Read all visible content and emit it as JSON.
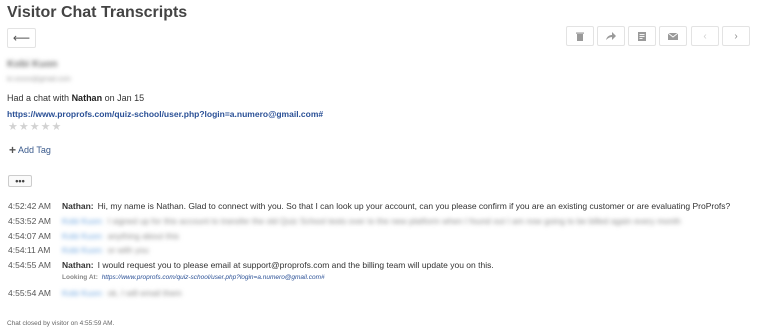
{
  "page": {
    "title": "Visitor Chat Transcripts"
  },
  "toolbar": {
    "back_icon": "arrow-left-icon",
    "actions": [
      "trash-icon",
      "forward-icon",
      "note-icon",
      "envelope-icon",
      "chevron-left-icon",
      "chevron-right-icon"
    ],
    "glyphs": {
      "back": "⟵",
      "delete": "🗑",
      "forward": "➦",
      "note": "▤",
      "mail": "✉",
      "prev": "‹",
      "next": "›"
    }
  },
  "visitor": {
    "name": "Kobi Kuon",
    "email": "kr.xxxxx@gmail.com",
    "chat_prefix": "Had a chat with",
    "agent": "Nathan",
    "chat_suffix": "on Jan 15",
    "page_url": "https://www.proprofs.com/quiz-school/user.php?login=a.numero@gmail.com#",
    "rating": 0,
    "stars": [
      "★",
      "★",
      "★",
      "★",
      "★"
    ]
  },
  "tags": {
    "add_label": "Add Tag",
    "plus": "+"
  },
  "more_label": "•••",
  "messages": [
    {
      "time": "4:52:42 AM",
      "sender": "Nathan:",
      "type": "agent",
      "text": "Hi, my name is Nathan. Glad to connect with you. So that I can look up your account, can you please confirm if you are an existing customer or are evaluating ProProfs?"
    },
    {
      "time": "4:53:52 AM",
      "sender": "Kobi Kuon:",
      "type": "visitor",
      "text": "I signed up for this account to transfer the old Quiz School tests over to the new platform when I found out I am now going to be billed again every month"
    },
    {
      "time": "4:54:07 AM",
      "sender": "Kobi Kuon:",
      "type": "visitor",
      "text": "anything about this"
    },
    {
      "time": "4:54:11 AM",
      "sender": "Kobi Kuon:",
      "type": "visitor",
      "text": "or with you"
    },
    {
      "time": "4:54:55 AM",
      "sender": "Nathan:",
      "type": "agent",
      "text": "I would request you to please email at support@proprofs.com and the billing team will update you on this."
    },
    {
      "time": "4:55:54 AM",
      "sender": "Kobi Kuon:",
      "type": "visitor",
      "text": "ok, I will email them"
    }
  ],
  "looking_at": {
    "label": "Looking At:",
    "url": "https://www.proprofs.com/quiz-school/user.php?login=a.numero@gmail.com#"
  },
  "footer": {
    "closed_note": "Chat closed by visitor on 4:55:59 AM."
  }
}
